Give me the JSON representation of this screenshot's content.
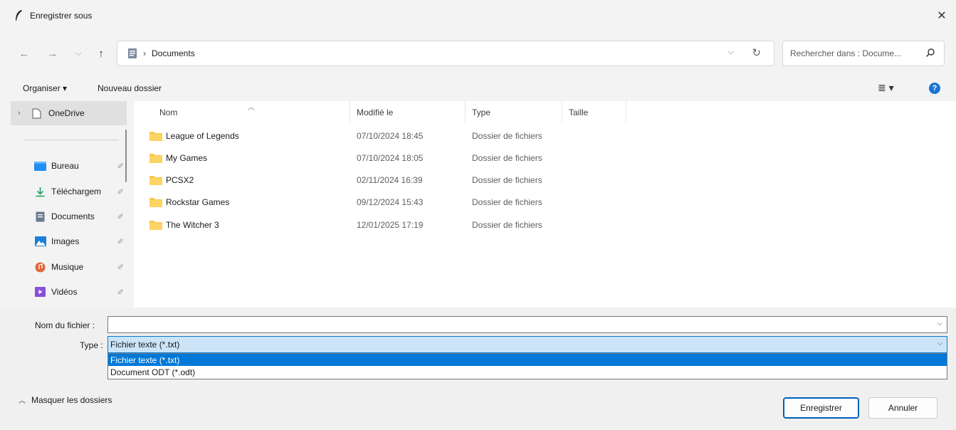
{
  "window": {
    "title": "Enregistrer sous",
    "close_icon": "close-icon"
  },
  "nav": {
    "back_icon": "arrow-left-icon",
    "forward_icon": "arrow-right-icon",
    "recent_icon": "chevron-down-icon",
    "up_icon": "arrow-up-icon",
    "breadcrumb_sep": "›",
    "path": "Documents",
    "search_placeholder": "Rechercher dans : Docume..."
  },
  "toolbar": {
    "organise": "Organiser ▾",
    "new_folder": "Nouveau dossier",
    "view_icon": "view-list-icon",
    "help": "?"
  },
  "sidebar": {
    "onedrive": "OneDrive",
    "items": [
      {
        "label": "Bureau",
        "icon": "desktop-icon",
        "color": "#1f8ef1"
      },
      {
        "label": "Téléchargem",
        "icon": "download-icon",
        "color": "#1aa260"
      },
      {
        "label": "Documents",
        "icon": "document-icon",
        "color": "#6b7a8f"
      },
      {
        "label": "Images",
        "icon": "image-icon",
        "color": "#1e7fd6"
      },
      {
        "label": "Musique",
        "icon": "music-icon",
        "color": "#e2673a"
      },
      {
        "label": "Vidéos",
        "icon": "video-icon",
        "color": "#8a4fd8"
      }
    ]
  },
  "columns": {
    "name": "Nom",
    "modified": "Modifié le",
    "type": "Type",
    "size": "Taille"
  },
  "files": [
    {
      "name": "League of Legends",
      "modified": "07/10/2024 18:45",
      "type": "Dossier de fichiers"
    },
    {
      "name": "My Games",
      "modified": "07/10/2024 18:05",
      "type": "Dossier de fichiers"
    },
    {
      "name": "PCSX2",
      "modified": "02/11/2024 16:39",
      "type": "Dossier de fichiers"
    },
    {
      "name": "Rockstar Games",
      "modified": "09/12/2024 15:43",
      "type": "Dossier de fichiers"
    },
    {
      "name": "The Witcher 3",
      "modified": "12/01/2025 17:19",
      "type": "Dossier de fichiers"
    }
  ],
  "form": {
    "filename_label": "Nom du fichier :",
    "filename_value": "",
    "type_label": "Type :",
    "type_value": "Fichier texte (*.txt)",
    "type_options": [
      "Fichier texte (*.txt)",
      "Document ODT (*.odt)"
    ]
  },
  "footer": {
    "hide_folders": "Masquer les dossiers",
    "save": "Enregistrer",
    "cancel": "Annuler"
  },
  "colors": {
    "accent": "#0078d7",
    "folder": "#f8c74a"
  }
}
